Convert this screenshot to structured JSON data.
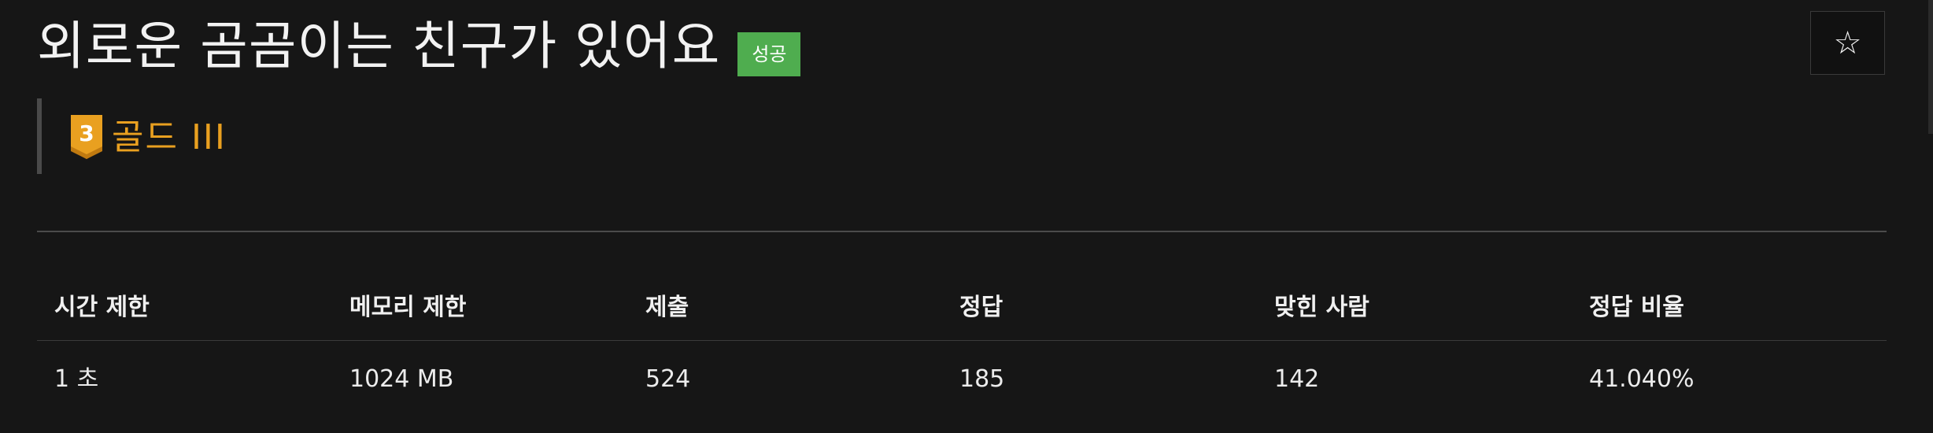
{
  "problem": {
    "title": "외로운 곰곰이는 친구가 있어요",
    "status_badge": "성공",
    "star_icon": "☆"
  },
  "tier": {
    "level_number": "3",
    "label": "골드 III",
    "color": "#e9a020",
    "icon": "gold-tier-badge-icon"
  },
  "table": {
    "headers": [
      "시간 제한",
      "메모리 제한",
      "제출",
      "정답",
      "맞힌 사람",
      "정답 비율"
    ],
    "rows": [
      [
        "1 초",
        "1024 MB",
        "524",
        "185",
        "142",
        "41.040%"
      ]
    ]
  },
  "colors": {
    "background": "#161616",
    "success": "#4fad4f",
    "gold": "#e9a020"
  }
}
